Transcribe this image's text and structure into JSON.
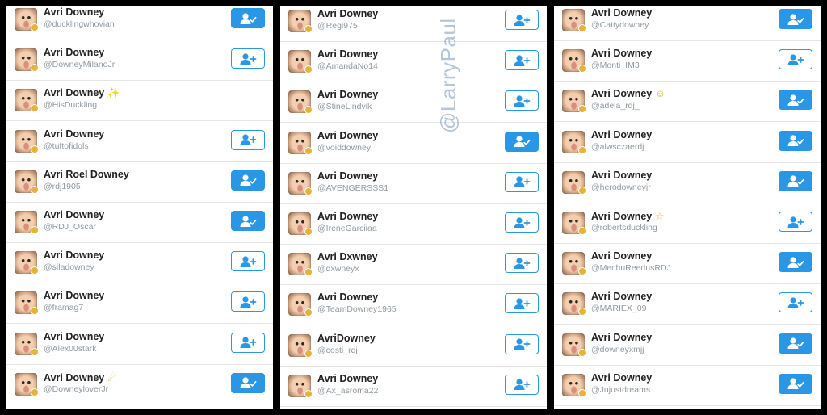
{
  "watermark": "@LarryPaul",
  "colors": {
    "accent": "#2996e6",
    "handle": "#8f9aa3"
  },
  "columns": [
    {
      "rows": [
        {
          "name": "Avri Downey",
          "emoji": "",
          "handle": "@ducklingwhovian",
          "button": "following"
        },
        {
          "name": "Avri Downey",
          "emoji": "",
          "handle": "@DowneyMilanoJr",
          "button": "follow"
        },
        {
          "name": "Avri Downey",
          "emoji": "✨",
          "handle": "@HisDuckling",
          "button": "none"
        },
        {
          "name": "Avri Downey",
          "emoji": "",
          "handle": "@tuftofidols",
          "button": "follow"
        },
        {
          "name": "Avri Roel Downey",
          "emoji": "",
          "handle": "@rdj1905",
          "button": "following"
        },
        {
          "name": "Avri Downey",
          "emoji": "",
          "handle": "@RDJ_Oscar",
          "button": "following"
        },
        {
          "name": "Avri Downey",
          "emoji": "",
          "handle": "@siladowney",
          "button": "follow"
        },
        {
          "name": "Avri Downey",
          "emoji": "",
          "handle": "@framag7",
          "button": "follow"
        },
        {
          "name": "Avri Downey",
          "emoji": "",
          "handle": "@Alex00stark",
          "button": "follow"
        },
        {
          "name": "Avri Downey",
          "emoji": "☄",
          "handle": "@DowneyloverJr",
          "button": "following"
        }
      ]
    },
    {
      "rows": [
        {
          "name": "Avri Downey",
          "emoji": "",
          "handle": "@Regi975",
          "button": "follow"
        },
        {
          "name": "Avri Downey",
          "emoji": "",
          "handle": "@AmandaNo14",
          "button": "follow"
        },
        {
          "name": "Avri Downey",
          "emoji": "",
          "handle": "@StineLindvik",
          "button": "follow"
        },
        {
          "name": "Avri Downey",
          "emoji": "",
          "handle": "@voiddowney",
          "button": "following"
        },
        {
          "name": "Avri Downey",
          "emoji": "",
          "handle": "@AVENGERSSS1",
          "button": "follow"
        },
        {
          "name": "Avri Downey",
          "emoji": "",
          "handle": "@IreneGarciiaa",
          "button": "follow"
        },
        {
          "name": "Avri Dxwney",
          "emoji": "",
          "handle": "@dxwneyx",
          "button": "follow"
        },
        {
          "name": "Avri Downey",
          "emoji": "",
          "handle": "@TeamDowney1965",
          "button": "follow"
        },
        {
          "name": "AvriDowney",
          "emoji": "",
          "handle": "@costi_rdj",
          "button": "follow"
        },
        {
          "name": "Avri Downey",
          "emoji": "",
          "handle": "@Ax_asroma22",
          "button": "follow"
        }
      ]
    },
    {
      "rows": [
        {
          "name": "Avri Downey",
          "emoji": "",
          "handle": "@Cattydowney",
          "button": "following"
        },
        {
          "name": "Avri Downey",
          "emoji": "",
          "handle": "@Monti_IM3",
          "button": "follow"
        },
        {
          "name": "Avri Downey",
          "emoji": "☺",
          "handle": "@adela_rdj_",
          "button": "following"
        },
        {
          "name": "Avri Downey",
          "emoji": "",
          "handle": "@alwsczaerdj",
          "button": "following"
        },
        {
          "name": "Avri Downey",
          "emoji": "",
          "handle": "@herodowneyjr",
          "button": "following"
        },
        {
          "name": "Avri Downey",
          "emoji": "☆",
          "handle": "@robertsduckling",
          "button": "follow"
        },
        {
          "name": "Avri Downey",
          "emoji": "",
          "handle": "@MechuReedusRDJ",
          "button": "following"
        },
        {
          "name": "Avri Downey",
          "emoji": "",
          "handle": "@MARIEX_09",
          "button": "follow"
        },
        {
          "name": "Avri Downey",
          "emoji": "",
          "handle": "@downeyxmjj",
          "button": "following"
        },
        {
          "name": "Avri Downey",
          "emoji": "",
          "handle": "@Jujustdreams",
          "button": "following"
        }
      ]
    }
  ]
}
